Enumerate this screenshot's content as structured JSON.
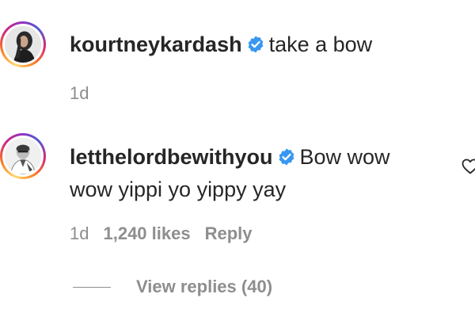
{
  "comments": [
    {
      "username": "kourtneykardash",
      "verified": true,
      "text_lines": [
        "take a bow"
      ],
      "time": "1d",
      "avatar_icon": "profile-photo"
    },
    {
      "username": "letthelordbewithyou",
      "verified": true,
      "text_lines": [
        "Bow wow",
        "wow yippi yo yippy yay"
      ],
      "time": "1d",
      "likes": "1,240 likes",
      "reply_label": "Reply",
      "like_icon": "heart-outline-icon",
      "avatar_icon": "profile-photo"
    }
  ],
  "view_replies": {
    "label": "View replies (40)"
  },
  "colors": {
    "text": "#262626",
    "secondary": "#8e8e8e",
    "verified_blue": "#3897f0"
  }
}
